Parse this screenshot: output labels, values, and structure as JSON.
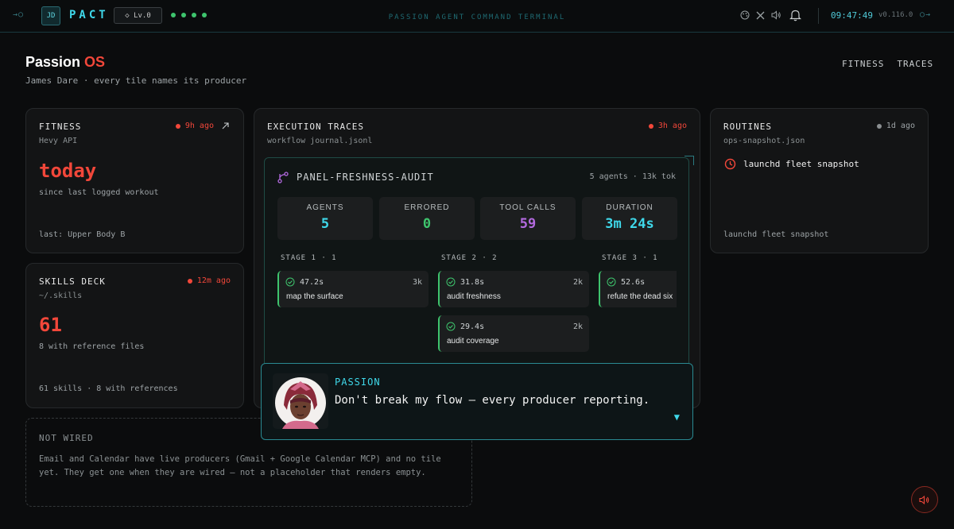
{
  "topbar": {
    "left_arrow": "→○",
    "avatar_initials": "JD",
    "brand": "PACT",
    "level": "◇ Lv.0",
    "status_dots": [
      true,
      true,
      true,
      true
    ],
    "center_title": "PASSION AGENT COMMAND TERMINAL",
    "icons": [
      "palette-icon",
      "x-logo-icon",
      "volume-icon",
      "bell-icon"
    ],
    "clock": "09:47:49",
    "version": "v0.116.0",
    "right_arrow": "○→"
  },
  "header": {
    "title_main": "Passion",
    "title_accent": "OS",
    "subtitle": "James Dare · every tile names its producer",
    "nav": [
      "FITNESS",
      "TRACES"
    ]
  },
  "fitness": {
    "title": "FITNESS",
    "age": "9h ago",
    "source": "Hevy API",
    "headline": "today",
    "caption": "since last logged workout",
    "footer": "last: Upper Body B"
  },
  "skills": {
    "title": "SKILLS DECK",
    "age": "12m ago",
    "source": "~/.skills",
    "headline": "61",
    "caption": "8 with reference files",
    "footer": "61 skills · 8 with references"
  },
  "traces": {
    "title": "EXECUTION TRACES",
    "age": "3h ago",
    "source": "workflow journal.jsonl",
    "panel": {
      "name": "PANEL-FRESHNESS-AUDIT",
      "meta": "5 agents · 13k tok",
      "stats": [
        {
          "label": "AGENTS",
          "value": "5",
          "color": "#3fd8ea"
        },
        {
          "label": "ERRORED",
          "value": "0",
          "color": "#3ec46d"
        },
        {
          "label": "TOOL CALLS",
          "value": "59",
          "color": "#b36ae0"
        },
        {
          "label": "DURATION",
          "value": "3m 24s",
          "color": "#3fd8ea"
        }
      ],
      "stages": [
        {
          "label": "STAGE 1 · 1",
          "agents": [
            {
              "time": "47.2s",
              "tok": "3k",
              "name": "map the surface"
            }
          ]
        },
        {
          "label": "STAGE 2 · 2",
          "agents": [
            {
              "time": "31.8s",
              "tok": "2k",
              "name": "audit freshness"
            },
            {
              "time": "29.4s",
              "tok": "2k",
              "name": "audit coverage"
            }
          ]
        },
        {
          "label": "STAGE 3 · 1",
          "agents": [
            {
              "time": "52.6s",
              "tok": "",
              "name": "refute the dead six"
            }
          ]
        }
      ]
    }
  },
  "routines": {
    "title": "ROUTINES",
    "age": "1d ago",
    "source": "ops-snapshot.json",
    "item": "launchd fleet snapshot",
    "footer": "launchd fleet snapshot"
  },
  "dialog": {
    "speaker": "PASSION",
    "text": "Don't break my flow — every producer reporting.",
    "continue": "▼"
  },
  "not_wired": {
    "title": "NOT WIRED",
    "body": "Email and Calendar have live producers (Gmail + Google Calendar MCP) and no tile yet. They get one when they are wired — not a placeholder that renders empty."
  },
  "colors": {
    "accent_cyan": "#3fd8ea",
    "accent_red": "#f2473a",
    "success_green": "#3ec46d",
    "purple": "#b36ae0"
  }
}
